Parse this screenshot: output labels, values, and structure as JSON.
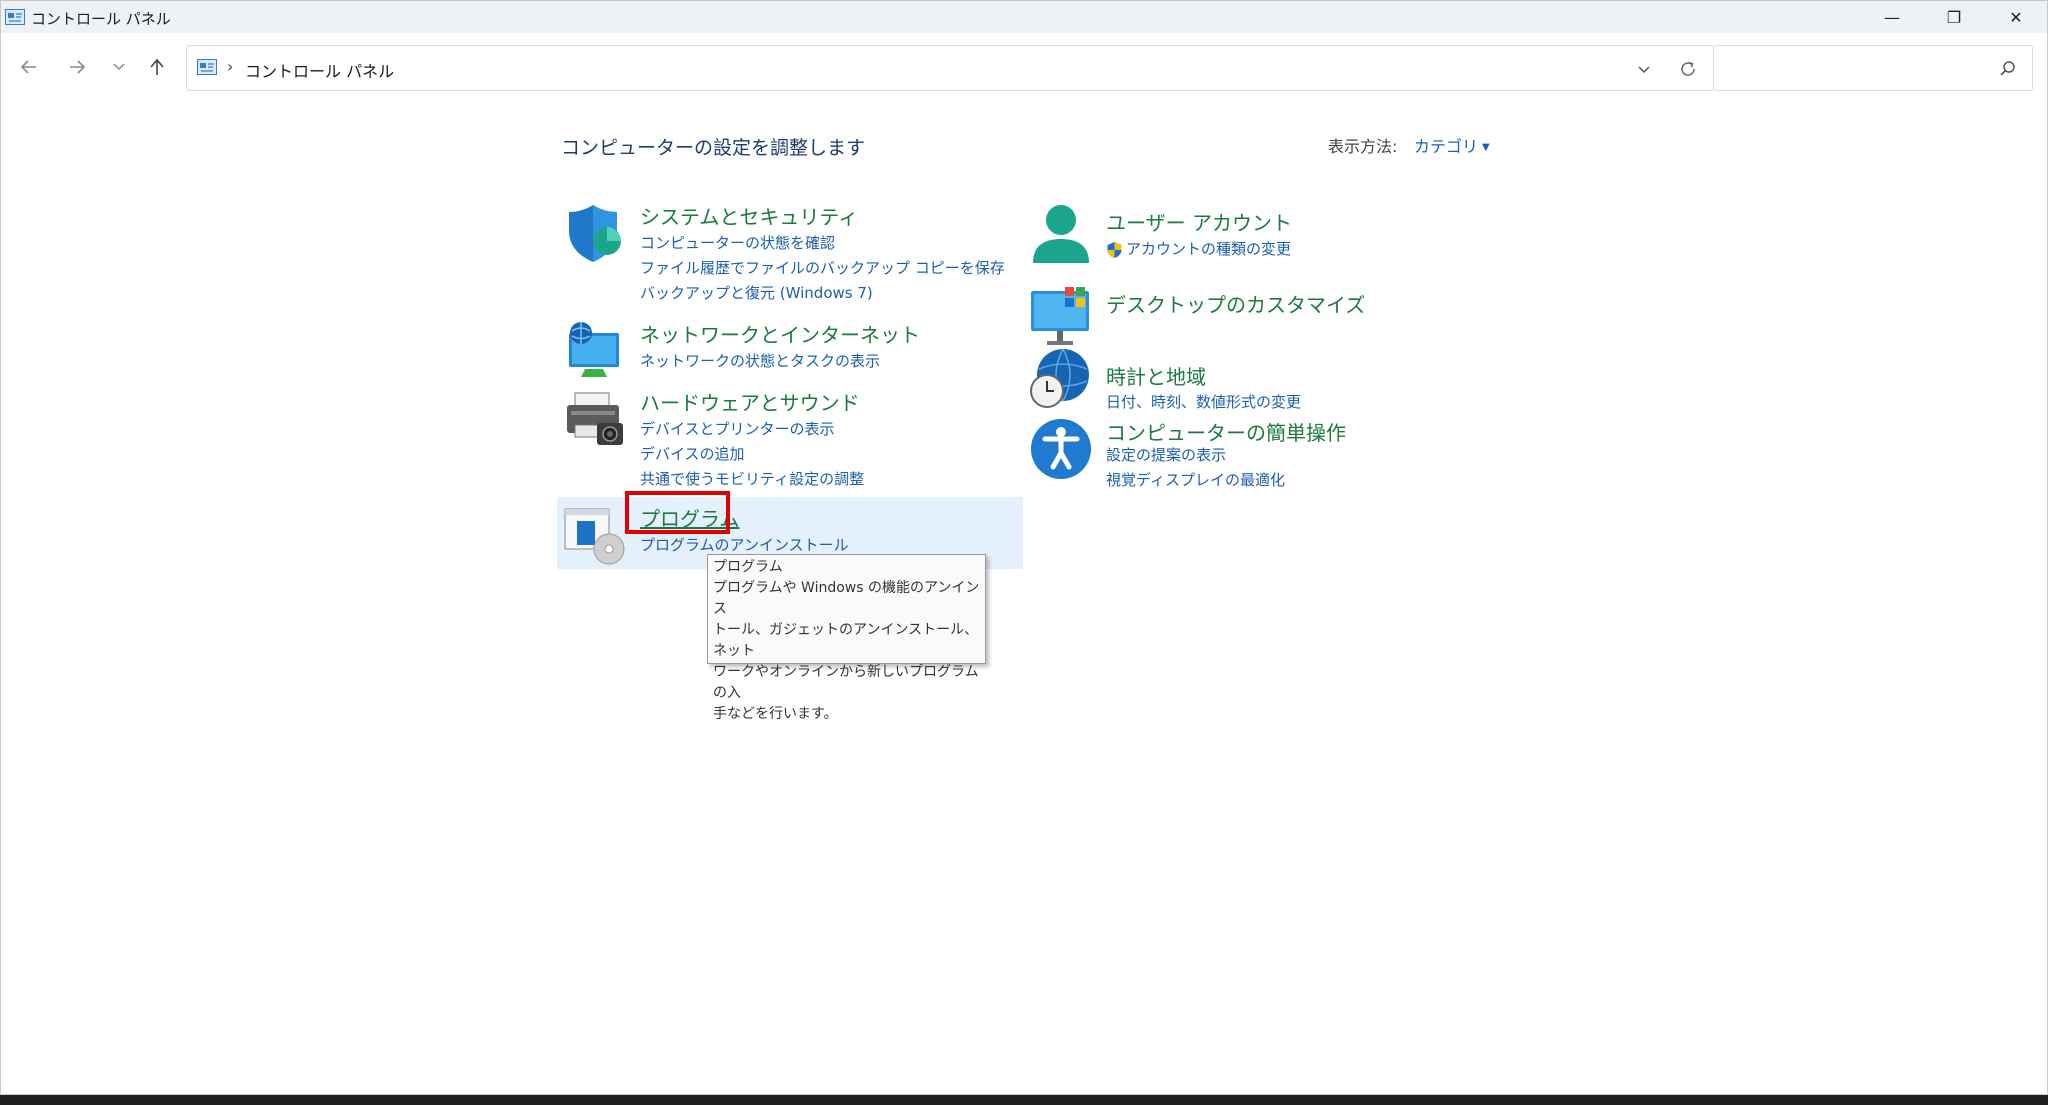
{
  "window": {
    "title": "コントロール パネル",
    "controls": {
      "minimize": "—",
      "maximize": "❐",
      "close": "✕"
    }
  },
  "address": {
    "breadcrumb": "コントロール パネル",
    "separator": "›",
    "search_placeholder": ""
  },
  "header": {
    "page_title": "コンピューターの設定を調整します",
    "view_label": "表示方法:",
    "view_value": "カテゴリ"
  },
  "left_categories": [
    {
      "title": "システムとセキュリティ",
      "links": [
        "コンピューターの状態を確認",
        "ファイル履歴でファイルのバックアップ コピーを保存",
        "バックアップと復元 (Windows 7)"
      ]
    },
    {
      "title": "ネットワークとインターネット",
      "links": [
        "ネットワークの状態とタスクの表示"
      ]
    },
    {
      "title": "ハードウェアとサウンド",
      "links": [
        "デバイスとプリンターの表示",
        "デバイスの追加",
        "共通で使うモビリティ設定の調整"
      ]
    },
    {
      "title": "プログラム",
      "links": [
        "プログラムのアンインストール"
      ]
    }
  ],
  "right_categories": [
    {
      "title": "ユーザー アカウント",
      "links": [
        "アカウントの種類の変更"
      ]
    },
    {
      "title": "デスクトップのカスタマイズ",
      "links": []
    },
    {
      "title": "時計と地域",
      "links": [
        "日付、時刻、数値形式の変更"
      ]
    },
    {
      "title": "コンピューターの簡単操作",
      "links": [
        "設定の提案の表示",
        "視覚ディスプレイの最適化"
      ]
    }
  ],
  "tooltip": {
    "title": "プログラム",
    "line1": "プログラムや Windows の機能のアンインス",
    "line2": "トール、ガジェットのアンインストール、ネット",
    "line3": "ワークやオンラインから新しいプログラムの入",
    "line4": "手などを行います。"
  },
  "colors": {
    "category_title": "#1b7a3d",
    "link": "#1a5fb4",
    "highlight": "#e4f0fb",
    "annotation": "#e00000"
  }
}
